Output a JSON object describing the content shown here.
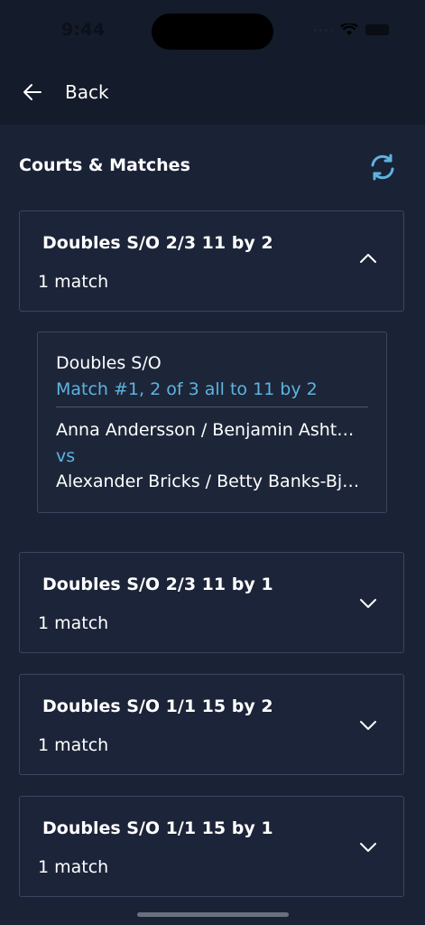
{
  "status_bar": {
    "time": "9:44"
  },
  "header": {
    "back_label": "Back"
  },
  "section": {
    "title": "Courts & Matches"
  },
  "groups": [
    {
      "title": "Doubles S/O 2/3 11 by 2",
      "count": "1 match",
      "expanded": true
    },
    {
      "title": "Doubles S/O 2/3 11 by 1",
      "count": "1 match",
      "expanded": false
    },
    {
      "title": "Doubles S/O 1/1 15 by 2",
      "count": "1 match",
      "expanded": false
    },
    {
      "title": "Doubles S/O 1/1 15 by 1",
      "count": "1 match",
      "expanded": false
    }
  ],
  "match": {
    "type": "Doubles S/O",
    "description": "Match #1, 2 of 3 all to 11 by 2",
    "team1": "Anna Andersson / Benjamin Asht…",
    "vs": "vs",
    "team2": "Alexander Bricks / Betty Banks-Bj…"
  },
  "colors": {
    "accent": "#5eb3e0",
    "background": "#1a2236",
    "header": "#141b2a",
    "card_border": "#3a4560"
  }
}
